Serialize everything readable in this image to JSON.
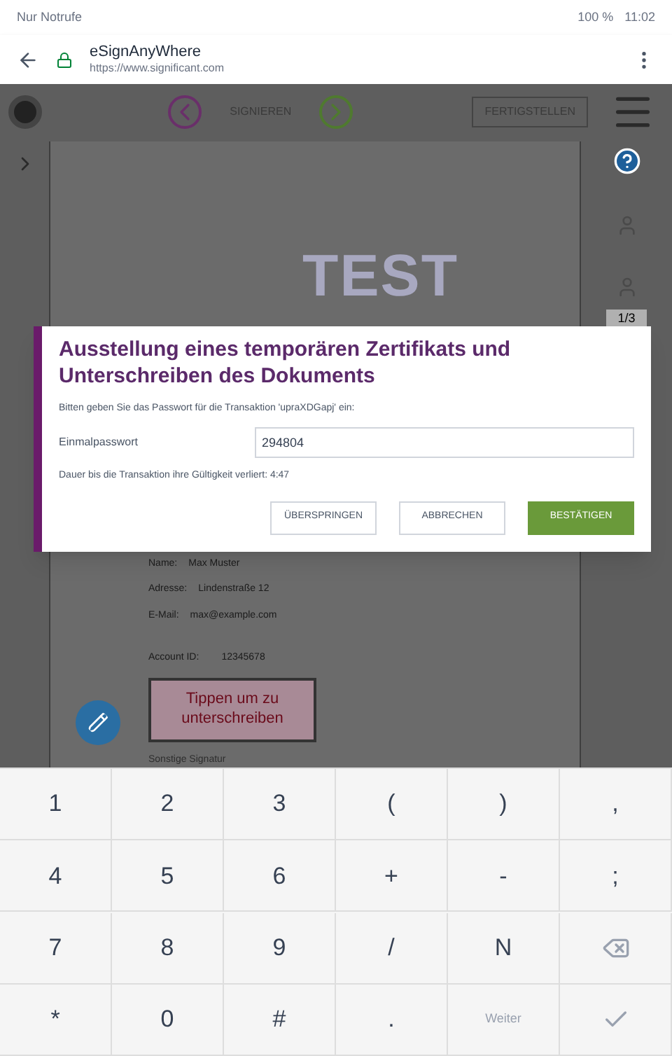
{
  "status_bar": {
    "carrier": "Nur Notrufe",
    "battery": "100 %",
    "time": "11:02"
  },
  "browser": {
    "title": "eSignAnyWhere",
    "url": "https://www.significant.com"
  },
  "toolbar": {
    "nav_label": "SIGNIEREN",
    "finish": "FERTIGSTELLEN",
    "page": "1/3"
  },
  "document": {
    "watermark": "TEST",
    "fields": [
      {
        "label": "Name:",
        "value": "Max Muster"
      },
      {
        "label": "Adresse:",
        "value": "Lindenstraße 12"
      },
      {
        "label": "E-Mail:",
        "value": "max@example.com"
      }
    ],
    "account_label": "Account ID:",
    "account_value": "12345678",
    "signature_prompt": "Tippen um zu unterschreiben",
    "signature_caption": "Sonstige Signatur"
  },
  "dialog": {
    "title": "Ausstellung eines temporären Zertifikats und Unterschreiben des Dokuments",
    "prompt": "Bitten geben Sie das Passwort für die Transaktion 'upraXDGapj' ein:",
    "field_label": "Einmalpasswort",
    "value": "294804",
    "timer": "Dauer bis die Transaktion ihre Gültigkeit verliert: 4:47",
    "buttons": [
      {
        "label": "ÜBERSPRINGEN",
        "kind": "outline"
      },
      {
        "label": "ABBRECHEN",
        "kind": "outline"
      },
      {
        "label": "BESTÄTIGEN",
        "kind": "primary"
      }
    ]
  },
  "keyboard": [
    [
      {
        "label": "1",
        "kind": "key"
      },
      {
        "label": "2",
        "kind": "key"
      },
      {
        "label": "3",
        "kind": "key"
      },
      {
        "label": "(",
        "kind": "key"
      },
      {
        "label": ")",
        "kind": "key"
      },
      {
        "label": ",",
        "kind": "key"
      }
    ],
    [
      {
        "label": "4",
        "kind": "key"
      },
      {
        "label": "5",
        "kind": "key"
      },
      {
        "label": "6",
        "kind": "key"
      },
      {
        "label": "+",
        "kind": "key"
      },
      {
        "label": "-",
        "kind": "key"
      },
      {
        "label": ";",
        "kind": "key"
      }
    ],
    [
      {
        "label": "7",
        "kind": "key"
      },
      {
        "label": "8",
        "kind": "key"
      },
      {
        "label": "9",
        "kind": "key"
      },
      {
        "label": "/",
        "kind": "key"
      },
      {
        "label": "N",
        "kind": "key"
      },
      {
        "kind": "backspace"
      }
    ],
    [
      {
        "label": "*",
        "kind": "key"
      },
      {
        "label": "0",
        "kind": "key"
      },
      {
        "label": "#",
        "kind": "key"
      },
      {
        "label": ".",
        "kind": "key"
      },
      {
        "label": "Weiter",
        "kind": "small"
      },
      {
        "kind": "done"
      }
    ]
  ]
}
